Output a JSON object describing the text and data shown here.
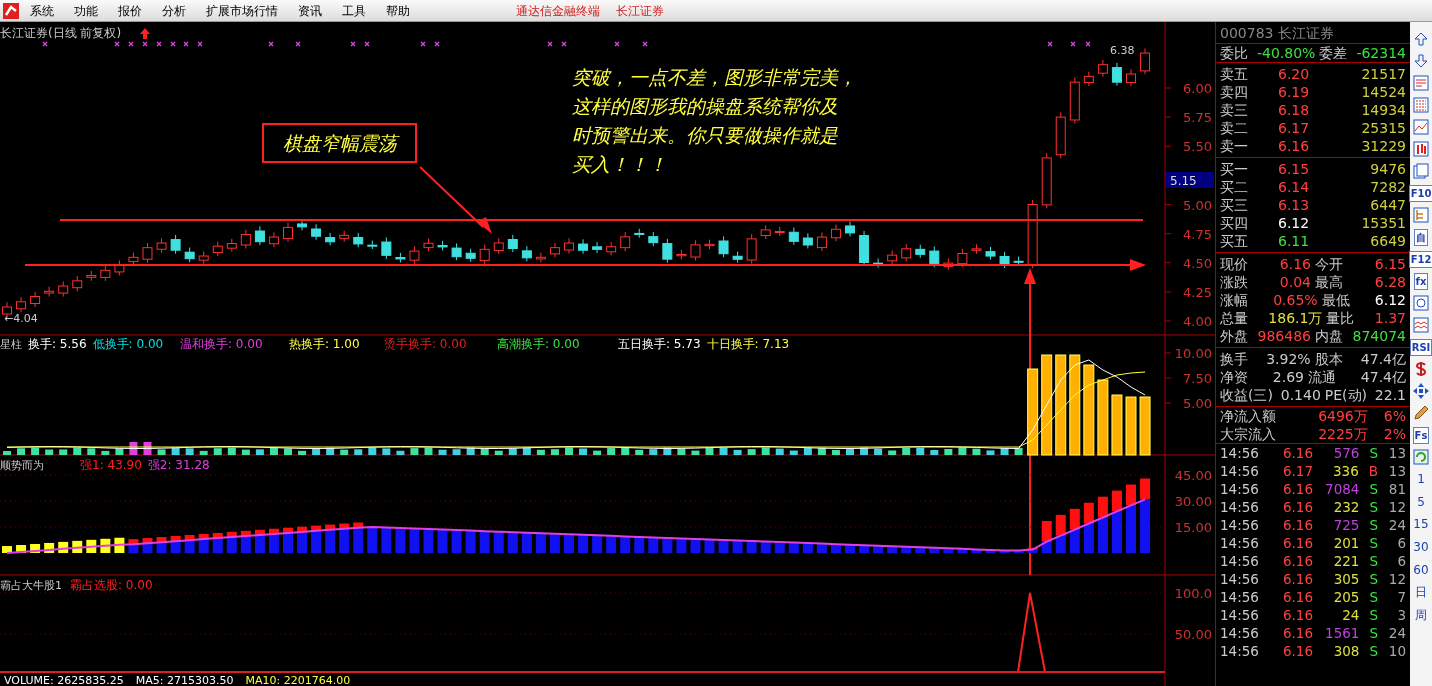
{
  "menu": {
    "items": [
      "系统",
      "功能",
      "报价",
      "分析",
      "扩展市场行情",
      "资讯",
      "工具",
      "帮助"
    ],
    "title": [
      "通达信金融终端",
      "长江证券"
    ]
  },
  "price_panel": {
    "title": "长江证券(日线 前复权)",
    "high_label": "6.38",
    "low_label": "←4.04",
    "axis": [
      "6.00",
      "5.75",
      "5.50",
      "5.00",
      "4.75",
      "4.50",
      "4.25",
      "4.00"
    ],
    "cursor": "5.15",
    "callout": "棋盘窄幅震荡",
    "note": [
      "突破，一点不差，图形非常完美，",
      "这样的图形我的操盘系统帮你及",
      "时预警出来。你只要做操作就是",
      "买入！！！"
    ]
  },
  "volume_panel": {
    "name": "星柱",
    "readings": [
      {
        "text": "换手: 5.56",
        "color": "#ffffff"
      },
      {
        "text": "低换手: 0.00",
        "color": "#00e0e0"
      },
      {
        "text": "温和换手: 0.00",
        "color": "#e040e0"
      },
      {
        "text": "热换手: 1.00",
        "color": "#ffff40"
      },
      {
        "text": "烫手换手: 0.00",
        "color": "#e02020"
      },
      {
        "text": "高潮换手: 0.00",
        "color": "#40e040"
      },
      {
        "text": "五日换手: 5.73",
        "color": "#ffffff"
      },
      {
        "text": "十日换手: 7.13",
        "color": "#ffff40"
      }
    ],
    "axis": [
      "10.00",
      "7.50",
      "5.00"
    ]
  },
  "trend_panel": {
    "name": "顺势而为",
    "readings": [
      {
        "text": "强1: 43.90",
        "color": "#ff2020"
      },
      {
        "text": "强2: 31.28",
        "color": "#e040e0"
      }
    ],
    "axis": [
      "45.00",
      "30.00",
      "15.00"
    ]
  },
  "bull_panel": {
    "name": "霸占大牛股1",
    "readings": [
      {
        "text": "霸占选股: 0.00",
        "color": "#ff2020"
      }
    ],
    "axis": [
      "100.0",
      "50.00"
    ]
  },
  "footer_readings": [
    {
      "text": "VOLUME: 2625835.25",
      "color": "#ffffff"
    },
    {
      "text": "MA5: 2715303.50",
      "color": "#ffffff"
    },
    {
      "text": "MA10: 2201764.00",
      "color": "#ffff40"
    }
  ],
  "quote": {
    "header": "000783 长江证券",
    "ratio": {
      "label": "委比",
      "value": "-40.80%",
      "label2": "委差",
      "value2": "-62314"
    },
    "asks": [
      {
        "label": "卖五",
        "price": "6.20",
        "volume": "21517",
        "color": "#ff4040"
      },
      {
        "label": "卖四",
        "price": "6.19",
        "volume": "14524",
        "color": "#ff4040"
      },
      {
        "label": "卖三",
        "price": "6.18",
        "volume": "14934",
        "color": "#ff4040"
      },
      {
        "label": "卖二",
        "price": "6.17",
        "volume": "25315",
        "color": "#ff4040"
      },
      {
        "label": "卖一",
        "price": "6.16",
        "volume": "31229",
        "color": "#ff4040"
      }
    ],
    "bids": [
      {
        "label": "买一",
        "price": "6.15",
        "volume": "9476",
        "color": "#ff4040"
      },
      {
        "label": "买二",
        "price": "6.14",
        "volume": "7282",
        "color": "#ff4040"
      },
      {
        "label": "买三",
        "price": "6.13",
        "volume": "6447",
        "color": "#ff4040"
      },
      {
        "label": "买四",
        "price": "6.12",
        "volume": "15351",
        "color": "#ffffff"
      },
      {
        "label": "买五",
        "price": "6.11",
        "volume": "6649",
        "color": "#40e040"
      }
    ],
    "stats": [
      {
        "label": "现价",
        "value": "6.16",
        "color": "#ff4040"
      },
      {
        "label": "今开",
        "value": "6.15",
        "color": "#ff4040"
      },
      {
        "label": "涨跌",
        "value": "0.04",
        "color": "#ff4040"
      },
      {
        "label": "最高",
        "value": "6.28",
        "color": "#ff4040"
      },
      {
        "label": "涨幅",
        "value": "0.65%",
        "color": "#ff4040"
      },
      {
        "label": "最低",
        "value": "6.12",
        "color": "#ffffff"
      },
      {
        "label": "总量",
        "value": "186.1万",
        "color": "#e0e040"
      },
      {
        "label": "量比",
        "value": "1.37",
        "color": "#ff4040"
      },
      {
        "label": "外盘",
        "value": "986486",
        "color": "#ff4040"
      },
      {
        "label": "内盘",
        "value": "874074",
        "color": "#40e040"
      }
    ],
    "fundamentals": [
      {
        "label": "换手",
        "value": "3.92%",
        "label2": "股本",
        "value2": "47.4亿"
      },
      {
        "label": "净资",
        "value": "2.69",
        "label2": "流通",
        "value2": "47.4亿"
      },
      {
        "label": "收益(三)",
        "value": "0.140",
        "label2": "PE(动)",
        "value2": "22.1"
      }
    ],
    "flows": [
      {
        "label": "净流入额",
        "value": "6496万",
        "share": "6%"
      },
      {
        "label": "大宗流入",
        "value": "2225万",
        "share": "2%"
      }
    ],
    "ticks": [
      {
        "time": "14:56",
        "price": "6.16",
        "volume": "576",
        "color": "#c040e0",
        "side": "S",
        "count": "13"
      },
      {
        "time": "14:56",
        "price": "6.17",
        "volume": "336",
        "color": "#e0e040",
        "side": "B",
        "count": "13"
      },
      {
        "time": "14:56",
        "price": "6.16",
        "volume": "7084",
        "color": "#c040e0",
        "side": "S",
        "count": "81"
      },
      {
        "time": "14:56",
        "price": "6.16",
        "volume": "232",
        "color": "#e0e040",
        "side": "S",
        "count": "12"
      },
      {
        "time": "14:56",
        "price": "6.16",
        "volume": "725",
        "color": "#c040e0",
        "side": "S",
        "count": "24"
      },
      {
        "time": "14:56",
        "price": "6.16",
        "volume": "201",
        "color": "#e0e040",
        "side": "S",
        "count": "6"
      },
      {
        "time": "14:56",
        "price": "6.16",
        "volume": "221",
        "color": "#e0e040",
        "side": "S",
        "count": "6"
      },
      {
        "time": "14:56",
        "price": "6.16",
        "volume": "305",
        "color": "#e0e040",
        "side": "S",
        "count": "12"
      },
      {
        "time": "14:56",
        "price": "6.16",
        "volume": "205",
        "color": "#e0e040",
        "side": "S",
        "count": "7"
      },
      {
        "time": "14:56",
        "price": "6.16",
        "volume": "24",
        "color": "#e0e040",
        "side": "S",
        "count": "3"
      },
      {
        "time": "14:56",
        "price": "6.16",
        "volume": "1561",
        "color": "#c040e0",
        "side": "S",
        "count": "24"
      },
      {
        "time": "14:56",
        "price": "6.16",
        "volume": "308",
        "color": "#e0e040",
        "side": "S",
        "count": "10"
      }
    ]
  },
  "toolbar": [
    {
      "kind": "icon"
    },
    {
      "kind": "icon"
    },
    {
      "kind": "icon"
    },
    {
      "kind": "icon"
    },
    {
      "kind": "icon"
    },
    {
      "kind": "icon"
    },
    {
      "kind": "icon"
    },
    {
      "kind": "text",
      "text": "F10"
    },
    {
      "kind": "icon"
    },
    {
      "kind": "text",
      "text": "自"
    },
    {
      "kind": "text",
      "text": "F12"
    },
    {
      "kind": "text",
      "text": "fx"
    },
    {
      "kind": "icon"
    },
    {
      "kind": "icon"
    },
    {
      "kind": "text",
      "text": "RSI"
    },
    {
      "kind": "icon"
    },
    {
      "kind": "icon"
    },
    {
      "kind": "icon"
    },
    {
      "kind": "text",
      "text": "Fs"
    },
    {
      "kind": "icon"
    },
    {
      "kind": "period",
      "text": "1"
    },
    {
      "kind": "period",
      "text": "5"
    },
    {
      "kind": "period",
      "text": "15"
    },
    {
      "kind": "period",
      "text": "30"
    },
    {
      "kind": "period",
      "text": "60"
    },
    {
      "kind": "period",
      "text": "日"
    },
    {
      "kind": "period",
      "text": "周"
    }
  ]
}
